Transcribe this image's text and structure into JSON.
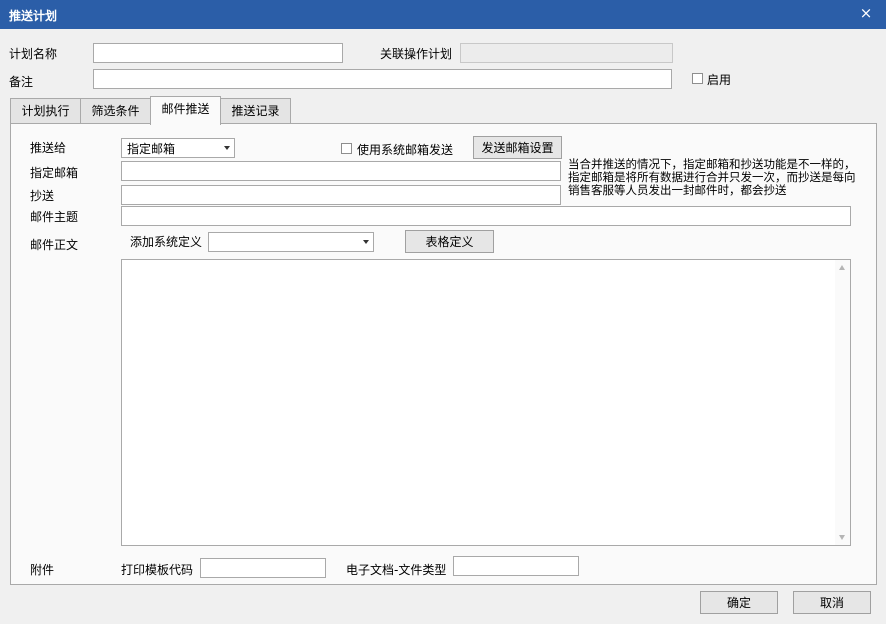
{
  "window": {
    "title": "推送计划",
    "close_glyph": "×"
  },
  "form": {
    "plan_name_label": "计划名称",
    "plan_name_value": "",
    "linked_plan_label": "关联操作计划",
    "linked_plan_value": "",
    "remark_label": "备注",
    "remark_value": "",
    "enable_label": "启用",
    "enable_checked": false
  },
  "tabs": [
    {
      "label": "计划执行",
      "active": false
    },
    {
      "label": "筛选条件",
      "active": false
    },
    {
      "label": "邮件推送",
      "active": true
    },
    {
      "label": "推送记录",
      "active": false
    }
  ],
  "email": {
    "push_to_label": "推送给",
    "push_to_value": "指定邮箱",
    "use_system_mail_label": "使用系统邮箱发送",
    "use_system_mail_checked": false,
    "mail_settings_button": "发送邮箱设置",
    "target_mail_label": "指定邮箱",
    "target_mail_value": "",
    "cc_label": "抄送",
    "cc_value": "",
    "note_line1": "当合并推送的情况下，指定邮箱和抄送功能是不一样的，",
    "note_line2": "指定邮箱是将所有数据进行合并只发一次，而抄送是每向",
    "note_line3": "销售客服等人员发出一封邮件时，都会抄送",
    "subject_label": "邮件主题",
    "subject_value": "",
    "body_label": "邮件正文",
    "add_system_def_label": "添加系统定义",
    "add_system_def_value": "",
    "table_def_button": "表格定义",
    "body_value": ""
  },
  "attachment": {
    "label": "附件",
    "print_template_label": "打印模板代码",
    "print_template_value": "",
    "doc_type_label": "电子文档-文件类型",
    "doc_type_value": ""
  },
  "footer": {
    "ok_button": "确定",
    "cancel_button": "取消"
  },
  "colors": {
    "titlebar": "#2b5ea8",
    "background": "#f0f0f0",
    "panel": "#fafafa",
    "border": "#a9a9a9"
  },
  "icons": {
    "close": "close-icon",
    "dropdown": "chevron-down-icon",
    "scroll_up": "scroll-up-icon",
    "scroll_down": "scroll-down-icon"
  }
}
